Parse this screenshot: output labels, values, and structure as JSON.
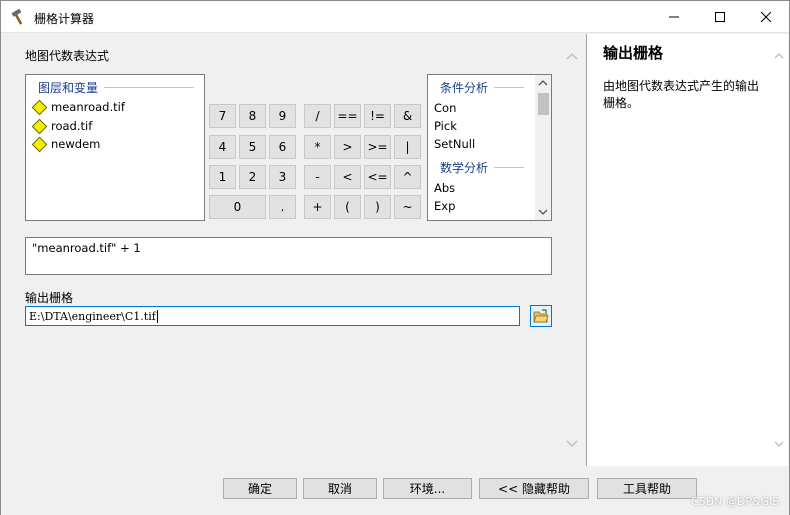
{
  "window": {
    "title": "栅格计算器",
    "controls": [
      "minimize",
      "maximize",
      "close"
    ]
  },
  "left": {
    "expr_label": "地图代数表达式",
    "layers_header": "图层和变量",
    "layers": [
      "meanroad.tif",
      "road.tif",
      "newdem"
    ],
    "buttons": [
      [
        "7",
        "8",
        "9",
        "/",
        "==",
        "!=",
        "&"
      ],
      [
        "4",
        "5",
        "6",
        "*",
        ">",
        ">=",
        "|"
      ],
      [
        "1",
        "2",
        "3",
        "-",
        "<",
        "<=",
        "^"
      ],
      [
        "0",
        ".",
        "+",
        "(",
        ")",
        "~"
      ]
    ],
    "functions": {
      "group1_header": "条件分析",
      "group1": [
        "Con",
        "Pick",
        "SetNull"
      ],
      "group2_header": "数学分析",
      "group2": [
        "Abs",
        "Exp"
      ]
    },
    "expression": "\"meanroad.tif\" + 1",
    "output_label": "输出栅格",
    "output_value": "E:\\DTA\\engineer\\C1.tif"
  },
  "help": {
    "title": "输出栅格",
    "text": "由地图代数表达式产生的输出栅格。"
  },
  "bottom": {
    "ok": "确定",
    "cancel": "取消",
    "env": "环境...",
    "hide_help": "<< 隐藏帮助",
    "tool_help": "工具帮助"
  },
  "watermark": "CSDN @DP&GIS",
  "colors": {
    "group_header": "#1a3e8c",
    "layer_icon": "#f5f000",
    "focus_border": "#0078d7"
  }
}
